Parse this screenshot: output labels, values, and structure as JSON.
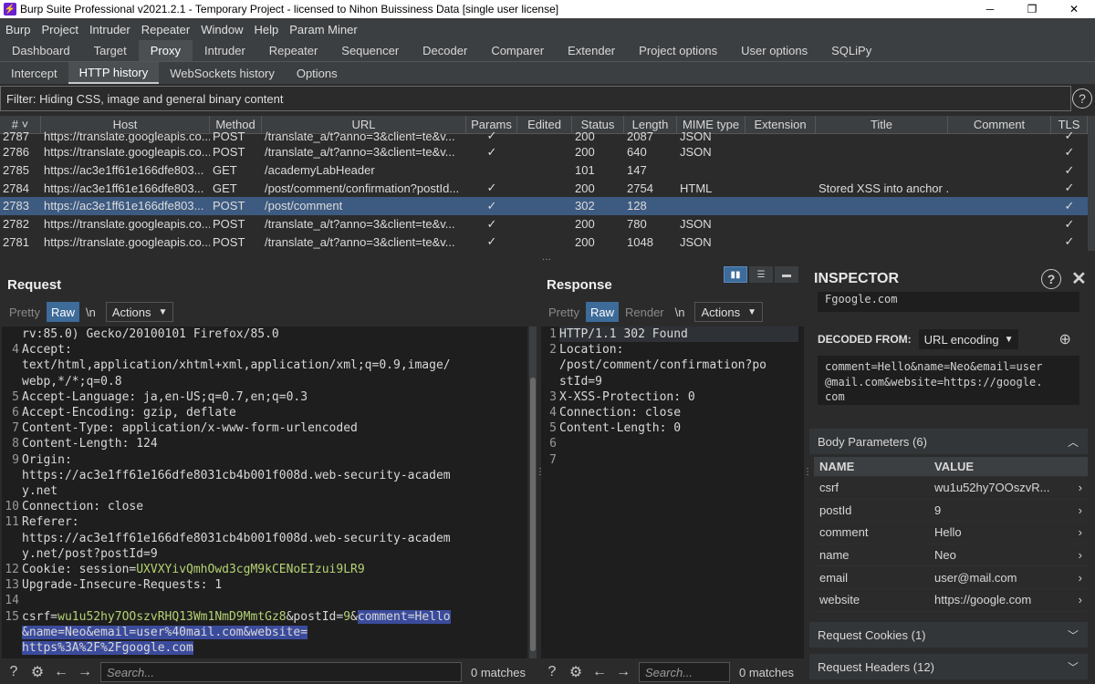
{
  "window": {
    "title": "Burp Suite Professional v2021.2.1 - Temporary Project - licensed to Nihon Buissiness Data [single user license]",
    "controls": [
      "─",
      "❐",
      "✕"
    ]
  },
  "menu": [
    "Burp",
    "Project",
    "Intruder",
    "Repeater",
    "Window",
    "Help",
    "Param Miner"
  ],
  "main_tabs": [
    "Dashboard",
    "Target",
    "Proxy",
    "Intruder",
    "Repeater",
    "Sequencer",
    "Decoder",
    "Comparer",
    "Extender",
    "Project options",
    "User options",
    "SQLiPy"
  ],
  "proxy_tabs": [
    "Intercept",
    "HTTP history",
    "WebSockets history",
    "Options"
  ],
  "filter": "Filter: Hiding CSS, image and general binary content",
  "help_glyph": "?",
  "history": {
    "columns": [
      "# ˅",
      "Host",
      "Method",
      "URL",
      "Params",
      "Edited",
      "Status",
      "Length",
      "MIME type",
      "Extension",
      "Title",
      "Comment",
      "TLS"
    ],
    "rows": [
      {
        "num": "2787",
        "host": "https://translate.googleapis.co...",
        "method": "POST",
        "url": "/translate_a/t?anno=3&client=te&v...",
        "params": "✓",
        "status": "200",
        "length": "2087",
        "mime": "JSON",
        "title": "",
        "tls": "✓",
        "partial": true
      },
      {
        "num": "2786",
        "host": "https://translate.googleapis.co...",
        "method": "POST",
        "url": "/translate_a/t?anno=3&client=te&v...",
        "params": "✓",
        "status": "200",
        "length": "640",
        "mime": "JSON",
        "title": "",
        "tls": "✓"
      },
      {
        "num": "2785",
        "host": "https://ac3e1ff61e166dfe803...",
        "method": "GET",
        "url": "/academyLabHeader",
        "params": "",
        "status": "101",
        "length": "147",
        "mime": "",
        "title": "",
        "tls": "✓"
      },
      {
        "num": "2784",
        "host": "https://ac3e1ff61e166dfe803...",
        "method": "GET",
        "url": "/post/comment/confirmation?postId...",
        "params": "✓",
        "status": "200",
        "length": "2754",
        "mime": "HTML",
        "title": "Stored XSS into anchor ...",
        "tls": "✓"
      },
      {
        "num": "2783",
        "host": "https://ac3e1ff61e166dfe803...",
        "method": "POST",
        "url": "/post/comment",
        "params": "✓",
        "status": "302",
        "length": "128",
        "mime": "",
        "title": "",
        "tls": "✓",
        "selected": true
      },
      {
        "num": "2782",
        "host": "https://translate.googleapis.co...",
        "method": "POST",
        "url": "/translate_a/t?anno=3&client=te&v...",
        "params": "✓",
        "status": "200",
        "length": "780",
        "mime": "JSON",
        "title": "",
        "tls": "✓"
      },
      {
        "num": "2781",
        "host": "https://translate.googleapis.co...",
        "method": "POST",
        "url": "/translate_a/t?anno=3&client=te&v...",
        "params": "✓",
        "status": "200",
        "length": "1048",
        "mime": "JSON",
        "title": "",
        "tls": "✓"
      }
    ]
  },
  "request": {
    "title": "Request",
    "tabs": [
      "Pretty",
      "Raw",
      "\\n"
    ],
    "actions": "Actions",
    "lines": [
      {
        "n": "",
        "t": "rv:85.0) Gecko/20100101 Firefox/85.0"
      },
      {
        "n": "4",
        "t": "Accept:"
      },
      {
        "n": "",
        "t": "text/html,application/xhtml+xml,application/xml;q=0.9,image/"
      },
      {
        "n": "",
        "t": "webp,*/*;q=0.8"
      },
      {
        "n": "5",
        "t": "Accept-Language: ja,en-US;q=0.7,en;q=0.3"
      },
      {
        "n": "6",
        "t": "Accept-Encoding: gzip, deflate"
      },
      {
        "n": "7",
        "t": "Content-Type: application/x-www-form-urlencoded"
      },
      {
        "n": "8",
        "t": "Content-Length: 124"
      },
      {
        "n": "9",
        "t": "Origin:"
      },
      {
        "n": "",
        "t": "https://ac3e1ff61e166dfe8031cb4b001f008d.web-security-academ"
      },
      {
        "n": "",
        "t": "y.net"
      },
      {
        "n": "10",
        "t": "Connection: close"
      },
      {
        "n": "11",
        "t": "Referer:"
      },
      {
        "n": "",
        "t": "https://ac3e1ff61e166dfe8031cb4b001f008d.web-security-academ"
      },
      {
        "n": "",
        "t": "y.net/post?postId=9"
      },
      {
        "n": "12",
        "t": "Cookie: session=",
        "green": "UXVXYivQmhOwd3cgM9kCENoEIzui9LR9"
      },
      {
        "n": "13",
        "t": "Upgrade-Insecure-Requests: 1"
      },
      {
        "n": "14",
        "t": ""
      },
      {
        "n": "15",
        "csrfk": "csrf=",
        "csrfv": "wu1u52hy7OOszvRHQ13Wm1NmD9MmtGz8",
        "mid": "&postId=",
        "pid": "9",
        "amp": "&",
        "selA": "comment=Hello"
      },
      {
        "n": "",
        "sel": "&name=Neo&email=user%40mail.com&website="
      },
      {
        "n": "",
        "sel": "https%3A%2F%2Fgoogle.com"
      }
    ]
  },
  "response": {
    "title": "Response",
    "tabs": [
      "Pretty",
      "Raw",
      "Render",
      "\\n"
    ],
    "actions": "Actions",
    "lines": [
      {
        "n": "1",
        "t": "HTTP/1.1 302 Found"
      },
      {
        "n": "2",
        "t": "Location:"
      },
      {
        "n": "",
        "t": "/post/comment/confirmation?po"
      },
      {
        "n": "",
        "t": "stId=9"
      },
      {
        "n": "3",
        "t": "X-XSS-Protection: 0"
      },
      {
        "n": "4",
        "t": "Connection: close"
      },
      {
        "n": "5",
        "t": "Content-Length: 0"
      },
      {
        "n": "6",
        "t": ""
      },
      {
        "n": "7",
        "t": ""
      }
    ]
  },
  "search": {
    "placeholder": "Search...",
    "matches": "0 matches"
  },
  "inspector": {
    "title": "INSPECTOR",
    "top_value": "Fgoogle.com",
    "decoded_label": "DECODED FROM:",
    "decoded_select": "URL encoding",
    "decoded_text": [
      "comment=Hello&name=Neo&email=user",
      "@mail.com&website=https://google.",
      "com"
    ],
    "body_params_title": "Body Parameters (6)",
    "param_headers": [
      "NAME",
      "VALUE"
    ],
    "params": [
      {
        "name": "csrf",
        "value": "wu1u52hy7OOszvR..."
      },
      {
        "name": "postId",
        "value": "9"
      },
      {
        "name": "comment",
        "value": "Hello"
      },
      {
        "name": "name",
        "value": "Neo"
      },
      {
        "name": "email",
        "value": "user@mail.com"
      },
      {
        "name": "website",
        "value": "https://google.com"
      }
    ],
    "cookies_title": "Request Cookies (1)",
    "headers_title": "Request Headers (12)"
  }
}
